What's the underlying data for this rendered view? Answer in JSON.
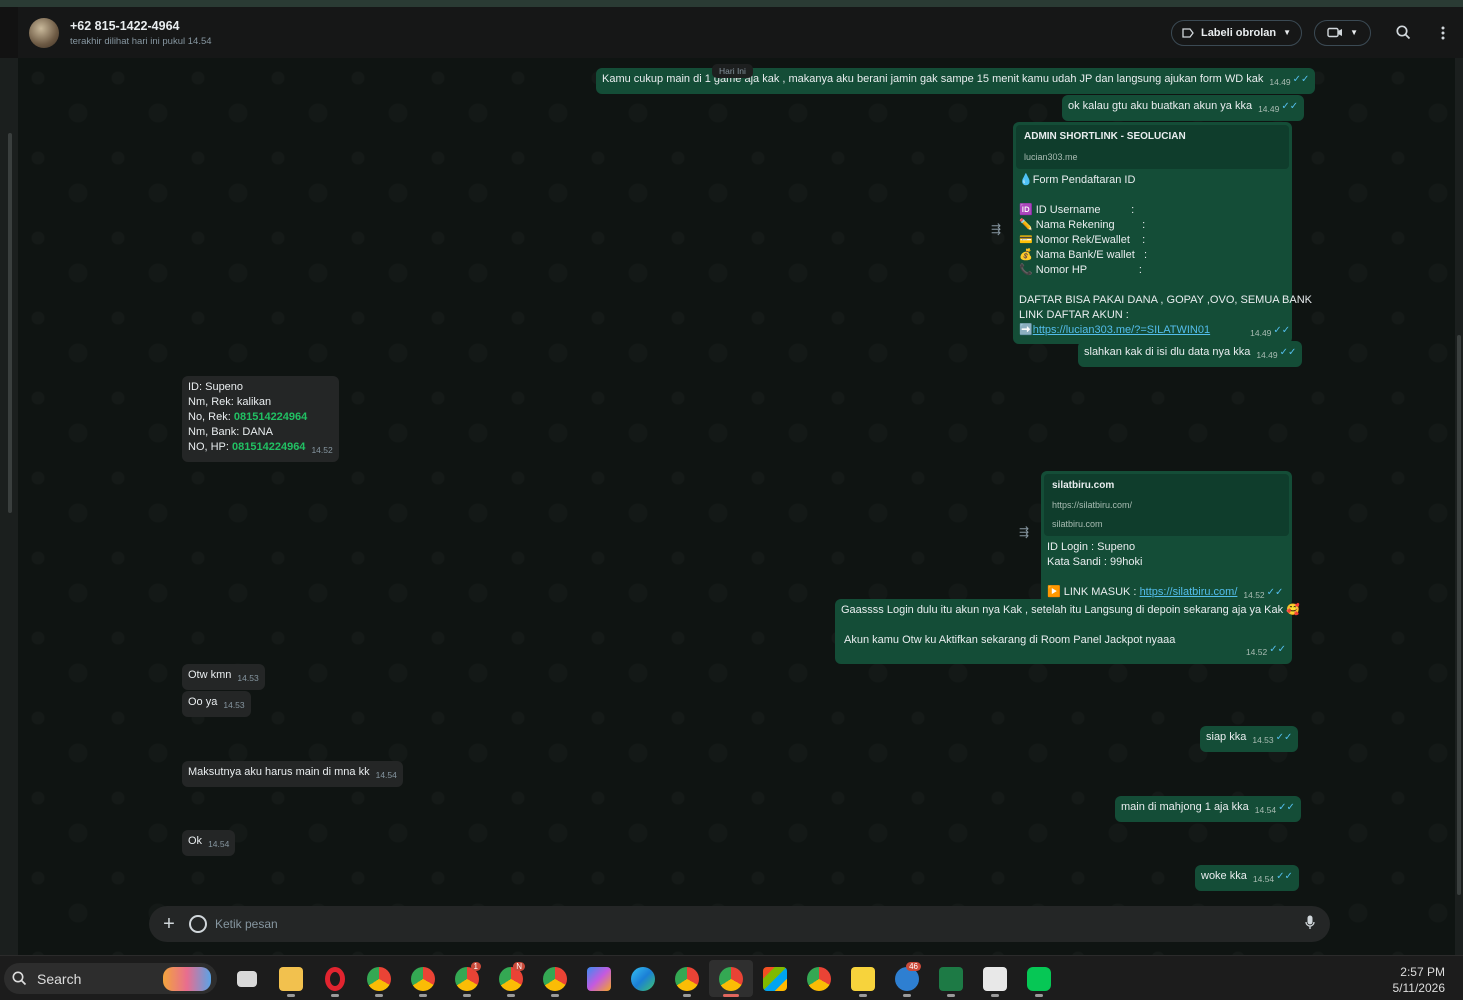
{
  "header": {
    "contact_name": "+62 815-1422-4964",
    "last_seen": "terakhir dilihat hari ini pukul 14.54",
    "label_button": "Labeli obrolan"
  },
  "day_divider": "Hari Ini",
  "messages": {
    "m1": {
      "text": "Kamu cukup main di 1 game aja kak , makanya aku  berani jamin gak sampe 15 menit kamu udah JP dan langsung ajukan form WD kak",
      "time": "14.49"
    },
    "m2": {
      "text": "ok kalau gtu aku buatkan akun ya kka",
      "time": "14.49"
    },
    "m3": {
      "card_title": "ADMIN SHORTLINK - SEOLUCIAN",
      "card_sub": "lucian303.me",
      "lines": [
        "💧Form Pendaftaran ID",
        "",
        "🆔 ID Username          :",
        "✏️ Nama Rekening         :",
        "💳 Nomor Rek/Ewallet    :",
        "💰 Nama Bank/E wallet   :",
        "📞 Nomor HP                 :",
        "",
        "DAFTAR BISA PAKAI DANA , GOPAY ,OVO, SEMUA BANK",
        "LINK DAFTAR AKUN :"
      ],
      "link": "https://lucian303.me/?=SILATWIN01",
      "time": "14.49"
    },
    "m4": {
      "text": "slahkan kak di isi dlu data nya kka",
      "time": "14.49"
    },
    "m5": {
      "l1": "ID: Supeno",
      "l2": "Nm, Rek: kalikan",
      "l3_label": "No, Rek: ",
      "l3_num": "081514224964",
      "l4": "Nm, Bank: DANA",
      "l5_label": "NO, HP: ",
      "l5_num": "081514224964",
      "time": "14.52"
    },
    "m6": {
      "card_title": "silatbiru.com",
      "card_url": "https://silatbiru.com/",
      "card_domain": "silatbiru.com",
      "l1": "ID Login : Supeno",
      "l2": "Kata Sandi : 99hoki",
      "l3_label": "▶️ LINK MASUK  : ",
      "link": "https://silatbiru.com/",
      "time": "14.52"
    },
    "m7": {
      "l1": "Gaassss Login dulu itu akun nya Kak  , setelah itu Langsung di depoin sekarang aja ya Kak 🥰",
      "l2": "Akun kamu Otw ku Aktifkan sekarang di Room Panel Jackpot nyaaa",
      "time": "14.52"
    },
    "m8": {
      "text": "Otw kmn",
      "time": "14.53"
    },
    "m9": {
      "text": "Oo ya",
      "time": "14.53"
    },
    "m10": {
      "text": "siap kka",
      "time": "14.53"
    },
    "m11": {
      "text": "Maksutnya aku harus main di mna kk",
      "time": "14.54"
    },
    "m12": {
      "text": "main di mahjong 1 aja kka",
      "time": "14.54"
    },
    "m13": {
      "text": "Ok",
      "time": "14.54"
    },
    "m14": {
      "text": "woke kka",
      "time": "14.54"
    }
  },
  "composer": {
    "placeholder": "Ketik pesan"
  },
  "taskbar": {
    "search_label": "Search",
    "time": "2:57 PM",
    "date": "5/11/2026",
    "badges": {
      "chrome3": "1",
      "chrome4": "N",
      "phone": "46"
    }
  },
  "colors": {
    "outgoing_bubble": "#144d37",
    "incoming_bubble": "#242626",
    "accent_green": "#21c063",
    "tick_blue": "#53bdeb"
  }
}
